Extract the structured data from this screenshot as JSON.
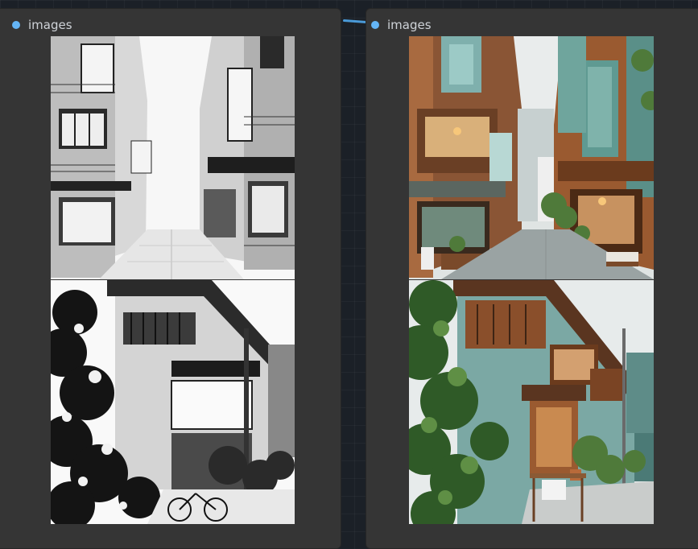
{
  "nodes": [
    {
      "title": "images",
      "icon": "output-port-dot"
    },
    {
      "title": "images",
      "icon": "input-port-dot"
    }
  ],
  "colors": {
    "canvas": "#1b2027",
    "node_bg": "#353535",
    "port": "#64b5f6",
    "wire": "#4a9ad8"
  }
}
